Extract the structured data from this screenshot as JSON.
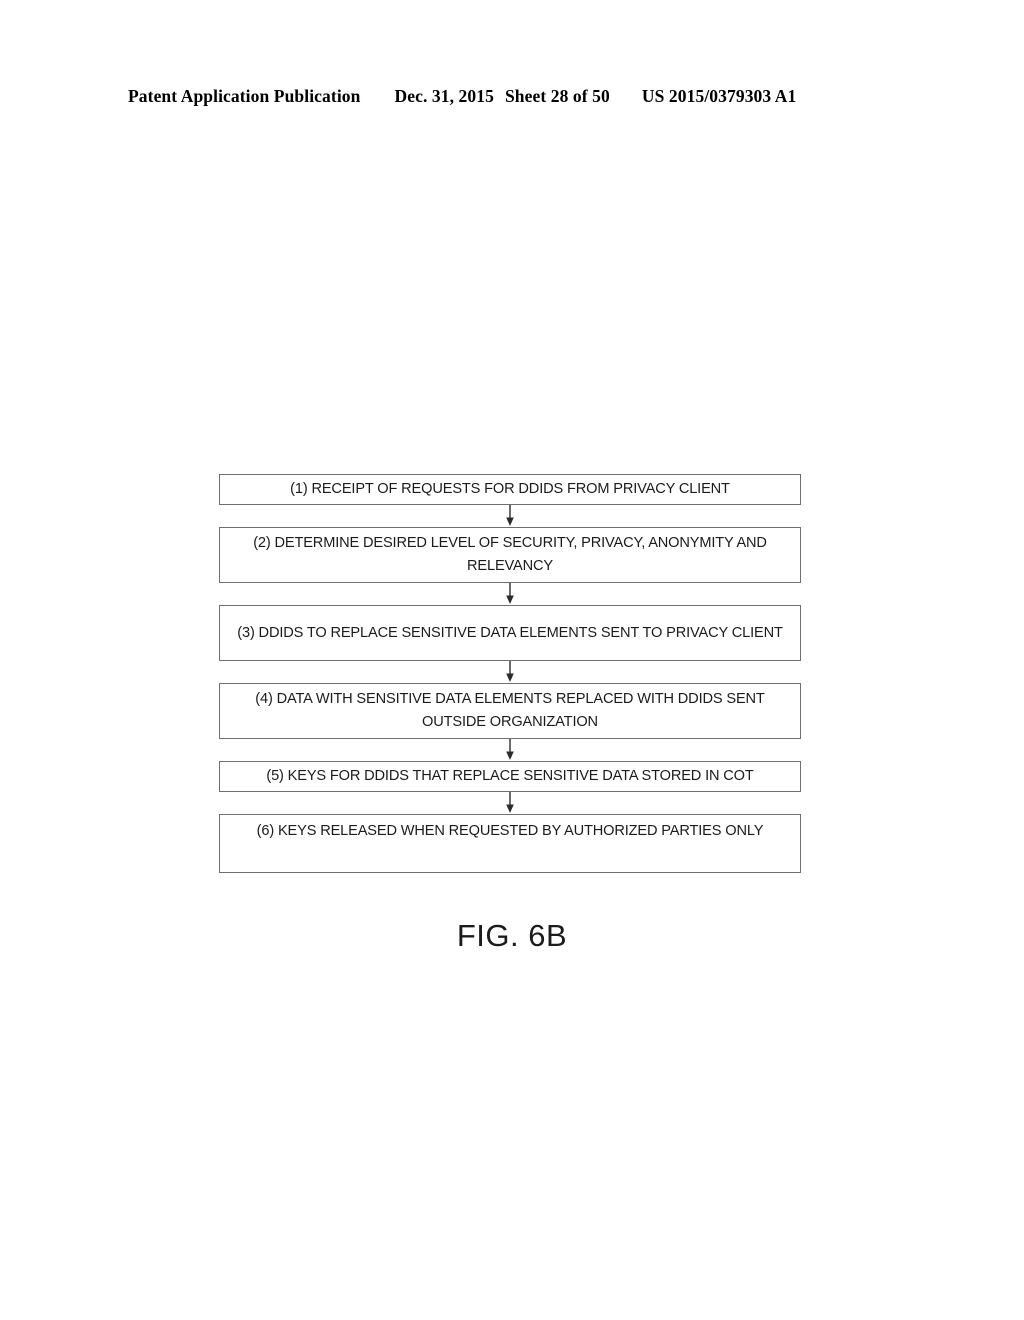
{
  "header": {
    "publication": "Patent Application Publication",
    "date": "Dec. 31, 2015",
    "sheet": "Sheet 28 of 50",
    "publication_number": "US 2015/0379303 A1"
  },
  "figure": {
    "caption": "FIG. 6B",
    "arrow_icon": "down-arrow-icon",
    "steps": [
      {
        "number": "(1)",
        "text": "(1) RECEIPT OF REQUESTS FOR DDIDS FROM PRIVACY CLIENT",
        "lines": 1
      },
      {
        "number": "(2)",
        "text": "(2) DETERMINE DESIRED LEVEL OF SECURITY, PRIVACY, ANONYMITY AND RELEVANCY",
        "lines": 2
      },
      {
        "number": "(3)",
        "text": "(3) DDIDS TO REPLACE SENSITIVE DATA ELEMENTS SENT TO PRIVACY CLIENT",
        "lines": 2
      },
      {
        "number": "(4)",
        "text": "(4) DATA WITH SENSITIVE DATA ELEMENTS REPLACED WITH DDIDS SENT OUTSIDE ORGANIZATION",
        "lines": 2
      },
      {
        "number": "(5)",
        "text": "(5) KEYS FOR DDIDS THAT REPLACE SENSITIVE DATA STORED IN COT",
        "lines": 1
      },
      {
        "number": "(6)",
        "text": "(6) KEYS RELEASED WHEN REQUESTED BY AUTHORIZED PARTIES ONLY",
        "lines": 1
      }
    ]
  },
  "colors": {
    "page_background": "#ffffff",
    "text": "#1b1b1b",
    "box_border": "#6f6f6f",
    "header_text": "#000000"
  }
}
